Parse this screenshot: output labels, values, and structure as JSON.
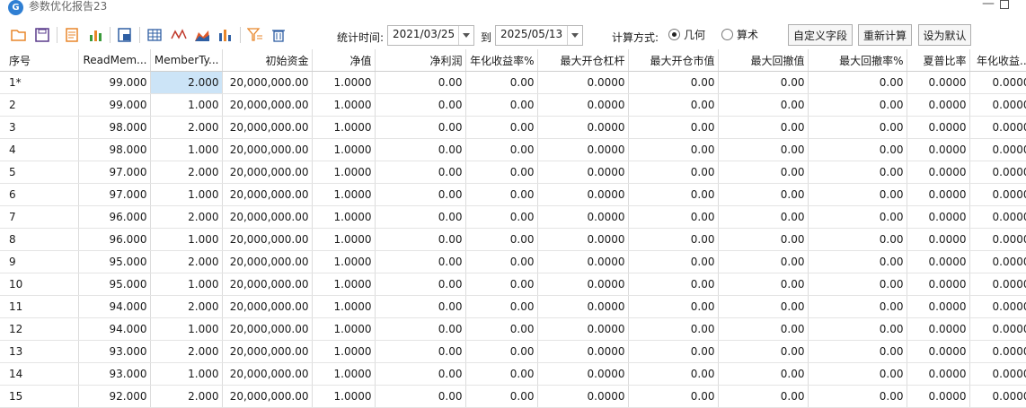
{
  "window": {
    "title": "参数优化报告23",
    "icon_text": "G",
    "minimize": "—"
  },
  "toolbar": {
    "stat_time_label": "统计时间:",
    "date_from": "2021/03/25",
    "to_label": "到",
    "date_to": "2025/05/13",
    "calc_method_label": "计算方式:",
    "radio_geometric": "几何",
    "radio_arithmetic": "算术",
    "selected_method": "geometric",
    "custom_fields_button": "自定义字段",
    "recalculate_button": "重新计算",
    "set_default_button": "设为默认"
  },
  "table": {
    "columns": [
      "序号",
      "ReadMem...",
      "MemberTy...",
      "初始资金",
      "净值",
      "净利润",
      "年化收益率%",
      "最大开仓杠杆",
      "最大开仓市值",
      "最大回撤值",
      "最大回撤率%",
      "夏普比率",
      "年化收益..."
    ],
    "rows": [
      [
        "1*",
        "99.000",
        "2.000",
        "20,000,000.00",
        "1.0000",
        "0.00",
        "0.00",
        "0.0000",
        "0.00",
        "0.00",
        "0.00",
        "0.0000",
        "0.0000"
      ],
      [
        "2",
        "99.000",
        "1.000",
        "20,000,000.00",
        "1.0000",
        "0.00",
        "0.00",
        "0.0000",
        "0.00",
        "0.00",
        "0.00",
        "0.0000",
        "0.0000"
      ],
      [
        "3",
        "98.000",
        "2.000",
        "20,000,000.00",
        "1.0000",
        "0.00",
        "0.00",
        "0.0000",
        "0.00",
        "0.00",
        "0.00",
        "0.0000",
        "0.0000"
      ],
      [
        "4",
        "98.000",
        "1.000",
        "20,000,000.00",
        "1.0000",
        "0.00",
        "0.00",
        "0.0000",
        "0.00",
        "0.00",
        "0.00",
        "0.0000",
        "0.0000"
      ],
      [
        "5",
        "97.000",
        "2.000",
        "20,000,000.00",
        "1.0000",
        "0.00",
        "0.00",
        "0.0000",
        "0.00",
        "0.00",
        "0.00",
        "0.0000",
        "0.0000"
      ],
      [
        "6",
        "97.000",
        "1.000",
        "20,000,000.00",
        "1.0000",
        "0.00",
        "0.00",
        "0.0000",
        "0.00",
        "0.00",
        "0.00",
        "0.0000",
        "0.0000"
      ],
      [
        "7",
        "96.000",
        "2.000",
        "20,000,000.00",
        "1.0000",
        "0.00",
        "0.00",
        "0.0000",
        "0.00",
        "0.00",
        "0.00",
        "0.0000",
        "0.0000"
      ],
      [
        "8",
        "96.000",
        "1.000",
        "20,000,000.00",
        "1.0000",
        "0.00",
        "0.00",
        "0.0000",
        "0.00",
        "0.00",
        "0.00",
        "0.0000",
        "0.0000"
      ],
      [
        "9",
        "95.000",
        "2.000",
        "20,000,000.00",
        "1.0000",
        "0.00",
        "0.00",
        "0.0000",
        "0.00",
        "0.00",
        "0.00",
        "0.0000",
        "0.0000"
      ],
      [
        "10",
        "95.000",
        "1.000",
        "20,000,000.00",
        "1.0000",
        "0.00",
        "0.00",
        "0.0000",
        "0.00",
        "0.00",
        "0.00",
        "0.0000",
        "0.0000"
      ],
      [
        "11",
        "94.000",
        "2.000",
        "20,000,000.00",
        "1.0000",
        "0.00",
        "0.00",
        "0.0000",
        "0.00",
        "0.00",
        "0.00",
        "0.0000",
        "0.0000"
      ],
      [
        "12",
        "94.000",
        "1.000",
        "20,000,000.00",
        "1.0000",
        "0.00",
        "0.00",
        "0.0000",
        "0.00",
        "0.00",
        "0.00",
        "0.0000",
        "0.0000"
      ],
      [
        "13",
        "93.000",
        "2.000",
        "20,000,000.00",
        "1.0000",
        "0.00",
        "0.00",
        "0.0000",
        "0.00",
        "0.00",
        "0.00",
        "0.0000",
        "0.0000"
      ],
      [
        "14",
        "93.000",
        "1.000",
        "20,000,000.00",
        "1.0000",
        "0.00",
        "0.00",
        "0.0000",
        "0.00",
        "0.00",
        "0.00",
        "0.0000",
        "0.0000"
      ],
      [
        "15",
        "92.000",
        "2.000",
        "20,000,000.00",
        "1.0000",
        "0.00",
        "0.00",
        "0.0000",
        "0.00",
        "0.00",
        "0.00",
        "0.0000",
        "0.0000"
      ]
    ],
    "selected_row": 0,
    "selected_col": 2
  },
  "colors": {
    "selection": "#cce4f7",
    "accent_blue": "#2f7fd3",
    "icon_orange": "#e8862a",
    "icon_green": "#3a9a3a"
  }
}
